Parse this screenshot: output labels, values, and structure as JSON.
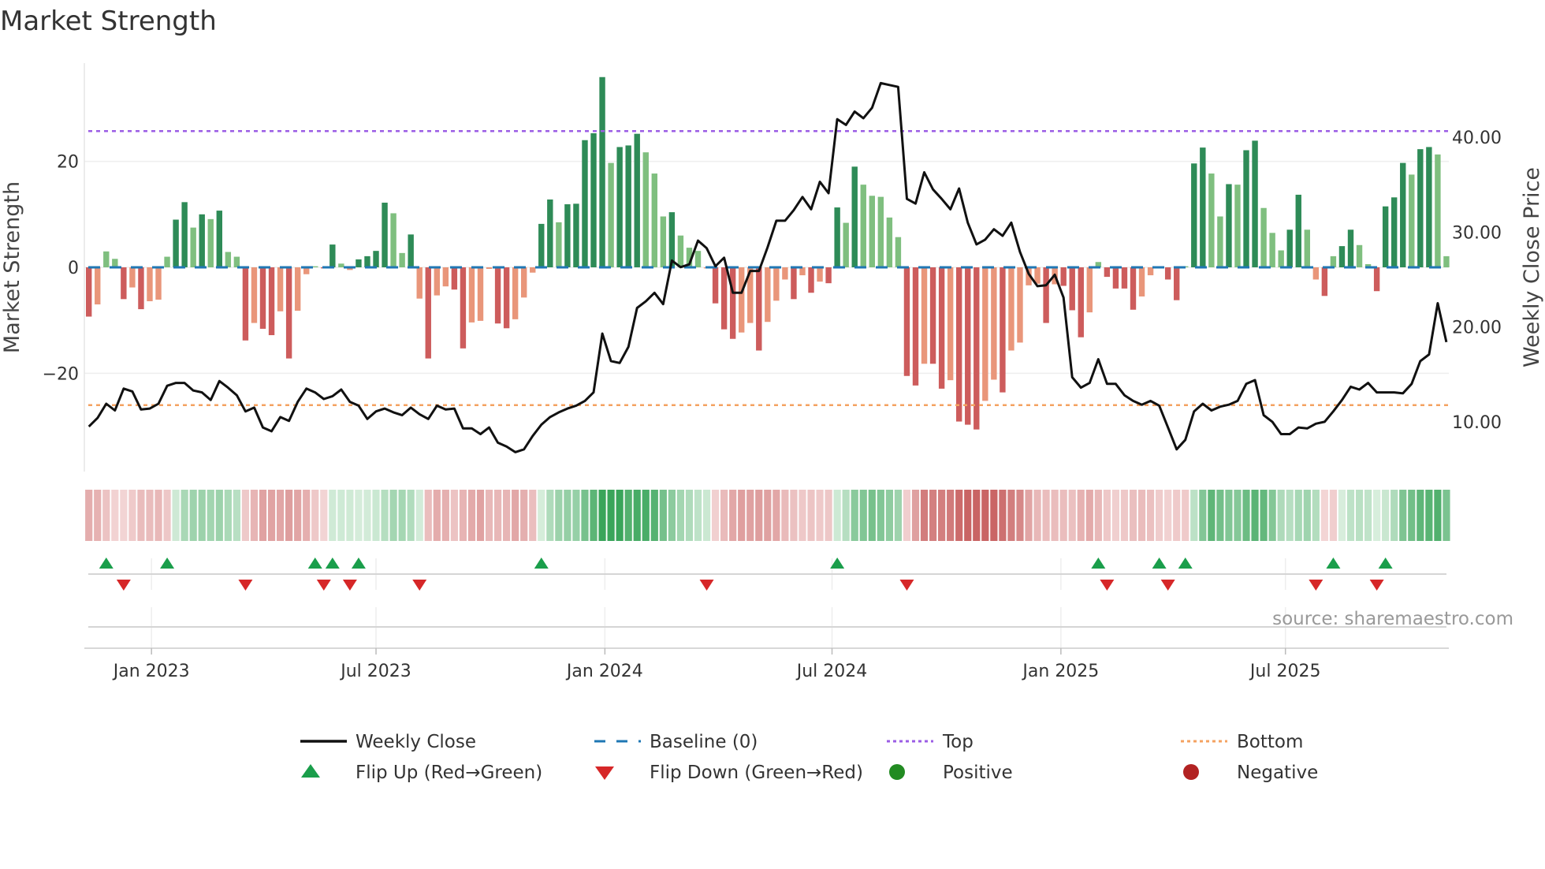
{
  "chart_data": {
    "type": "bar",
    "title": "Market Strength",
    "ylabel": "Market Strength",
    "y2label": "Weekly Close Price",
    "xlabel": "",
    "x_unit": "week index (weekly bars, ~Nov 2022 to Nov 2025)",
    "ylim": [
      -31,
      39
    ],
    "yticks": [
      {
        "value": -20,
        "label": "−20"
      },
      {
        "value": 0,
        "label": "0"
      },
      {
        "value": 20,
        "label": "20"
      }
    ],
    "y2lim": [
      5,
      46.5
    ],
    "y2ticks": [
      {
        "value": 10,
        "label": "10.00"
      },
      {
        "value": 20,
        "label": "20.00"
      },
      {
        "value": 30,
        "label": "30.00"
      },
      {
        "value": 40,
        "label": "40.00"
      }
    ],
    "xticks": [
      {
        "value": 8.2,
        "label": "Jan 2023"
      },
      {
        "value": 34.0,
        "label": "Jul 2023"
      },
      {
        "value": 60.3,
        "label": "Jan 2024"
      },
      {
        "value": 86.4,
        "label": "Jul 2024"
      },
      {
        "value": 112.7,
        "label": "Jan 2025"
      },
      {
        "value": 138.5,
        "label": "Jul 2025"
      }
    ],
    "grid": true,
    "top_level": 25.7,
    "bottom_level": -26.0,
    "baseline": 0,
    "strength": [
      -9.3,
      -7.0,
      3.0,
      1.6,
      -6.0,
      -3.8,
      -7.9,
      -6.4,
      -6.1,
      2.0,
      9.0,
      12.3,
      7.5,
      10.0,
      9.1,
      10.7,
      2.9,
      2.0,
      -13.8,
      -10.5,
      -11.6,
      -12.8,
      -8.3,
      -17.2,
      -8.2,
      -1.3,
      0.2,
      -0.2,
      4.3,
      0.7,
      -0.5,
      1.5,
      2.1,
      3.1,
      12.2,
      10.2,
      2.7,
      6.2,
      -5.9,
      -17.2,
      -5.3,
      -3.6,
      -4.2,
      -15.3,
      -10.4,
      -10.1,
      -0.3,
      -10.6,
      -11.5,
      -9.8,
      -5.7,
      -1.0,
      8.2,
      12.8,
      8.5,
      11.9,
      12.0,
      24.0,
      25.3,
      35.9,
      19.7,
      22.7,
      23.0,
      25.2,
      21.7,
      17.7,
      9.6,
      10.4,
      6.0,
      3.7,
      3.1,
      -0.2,
      -6.8,
      -11.7,
      -13.5,
      -12.3,
      -10.5,
      -15.7,
      -10.3,
      -6.3,
      -2.3,
      -6.0,
      -1.5,
      -4.8,
      -2.7,
      -3.0,
      11.3,
      8.4,
      19.0,
      15.6,
      13.5,
      13.3,
      9.4,
      5.7,
      -20.5,
      -22.3,
      -18.2,
      -18.2,
      -22.9,
      -21.3,
      -29.1,
      -29.7,
      -30.6,
      -25.2,
      -21.2,
      -23.6,
      -15.7,
      -14.2,
      -3.4,
      -3.1,
      -10.5,
      -3.2,
      -3.5,
      -8.1,
      -13.2,
      -8.5,
      1.0,
      -1.8,
      -4.0,
      -4.0,
      -8.0,
      -5.5,
      -1.5,
      0.2,
      -2.3,
      -6.2,
      0.2,
      19.6,
      22.6,
      17.7,
      9.6,
      15.7,
      15.6,
      22.1,
      23.9,
      11.2,
      6.5,
      3.2,
      7.1,
      13.7,
      7.1,
      -2.3,
      -5.4,
      2.1,
      4.0,
      7.1,
      4.2,
      0.6,
      -4.5,
      11.5,
      13.2,
      19.7,
      17.5,
      22.3,
      22.7,
      21.3,
      2.1
    ],
    "weekly_close": [
      9.5,
      10.4,
      11.9,
      11.2,
      13.5,
      13.2,
      11.3,
      11.4,
      11.9,
      13.8,
      14.1,
      14.1,
      13.3,
      13.1,
      12.3,
      14.3,
      13.6,
      12.8,
      11.1,
      11.5,
      9.4,
      9.0,
      10.5,
      10.1,
      12.1,
      13.5,
      13.1,
      12.4,
      12.7,
      13.4,
      12.1,
      11.7,
      10.3,
      11.1,
      11.4,
      11.0,
      10.7,
      11.5,
      10.8,
      10.3,
      11.7,
      11.3,
      11.4,
      9.3,
      9.3,
      8.7,
      9.4,
      7.8,
      7.4,
      6.8,
      7.1,
      8.5,
      9.7,
      10.5,
      11.0,
      11.4,
      11.7,
      12.2,
      13.1,
      19.3,
      16.4,
      16.2,
      17.9,
      22.0,
      22.7,
      23.6,
      22.4,
      27.0,
      26.3,
      26.6,
      29.1,
      28.3,
      26.4,
      27.3,
      23.6,
      23.6,
      25.9,
      25.9,
      28.4,
      31.2,
      31.2,
      32.3,
      33.7,
      32.4,
      35.3,
      34.1,
      41.9,
      41.3,
      42.7,
      42.0,
      43.1,
      45.7,
      45.5,
      45.3,
      33.5,
      33.0,
      36.3,
      34.5,
      33.5,
      32.4,
      34.6,
      31.0,
      28.7,
      29.2,
      30.3,
      29.6,
      31.0,
      27.9,
      25.6,
      24.3,
      24.4,
      25.5,
      23.1,
      14.7,
      13.6,
      14.1,
      16.6,
      14.0,
      14.0,
      12.8,
      12.2,
      11.8,
      12.2,
      11.7,
      9.4,
      7.1,
      8.1,
      11.1,
      11.9,
      11.2,
      11.6,
      11.8,
      12.2,
      14.0,
      14.4,
      10.7,
      10.0,
      8.7,
      8.7,
      9.4,
      9.3,
      9.8,
      10.0,
      11.1,
      12.3,
      13.7,
      13.4,
      14.1,
      13.1,
      13.1,
      13.1,
      13.0,
      14.0,
      16.4,
      17.1,
      22.5,
      18.4
    ],
    "flip_up_weeks": [
      3,
      10,
      27,
      29,
      32,
      53,
      87,
      117,
      124,
      127,
      144,
      150
    ],
    "flip_down_weeks": [
      5,
      19,
      28,
      31,
      39,
      72,
      95,
      118,
      125,
      142,
      149
    ],
    "legend_position": "bottom",
    "legend": [
      {
        "label": "Weekly Close",
        "symbol": "solid-line",
        "color": "#111111"
      },
      {
        "label": "Baseline (0)",
        "symbol": "dashed-line",
        "color": "#1f77b4"
      },
      {
        "label": "Top",
        "symbol": "dotted-line",
        "color": "#9b5de5"
      },
      {
        "label": "Bottom",
        "symbol": "dotted-line",
        "color": "#f4a261"
      },
      {
        "label": "Flip Up (Red→Green)",
        "symbol": "triangle-up",
        "color": "#1a9e4b"
      },
      {
        "label": "Flip Down (Green→Red)",
        "symbol": "triangle-down",
        "color": "#d62728"
      },
      {
        "label": "Positive",
        "symbol": "circle",
        "color": "#228b22"
      },
      {
        "label": "Negative",
        "symbol": "circle",
        "color": "#b22222"
      }
    ],
    "annotation": "source: sharemaestro.com",
    "colors": {
      "pos_strong": "#2e8b57",
      "pos_weak": "#7fbf7f",
      "neg_strong": "#cd5c5c",
      "neg_weak": "#e9967a"
    }
  }
}
